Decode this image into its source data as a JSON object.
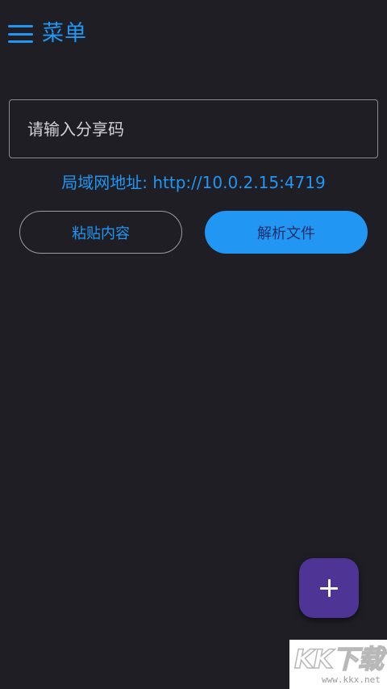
{
  "header": {
    "menu_label": "菜单"
  },
  "share_code": {
    "placeholder": "请输入分享码",
    "value": ""
  },
  "lan_address": "局域网地址: http://10.0.2.15:4719",
  "buttons": {
    "paste_label": "粘贴内容",
    "parse_label": "解析文件"
  },
  "fab": {
    "icon": "plus-icon"
  },
  "watermark": {
    "logo_text": "KK下载",
    "site": "www.kkx.net"
  },
  "colors": {
    "background": "#1e1e24",
    "accent": "#2196f3",
    "fab": "#4e3494"
  }
}
